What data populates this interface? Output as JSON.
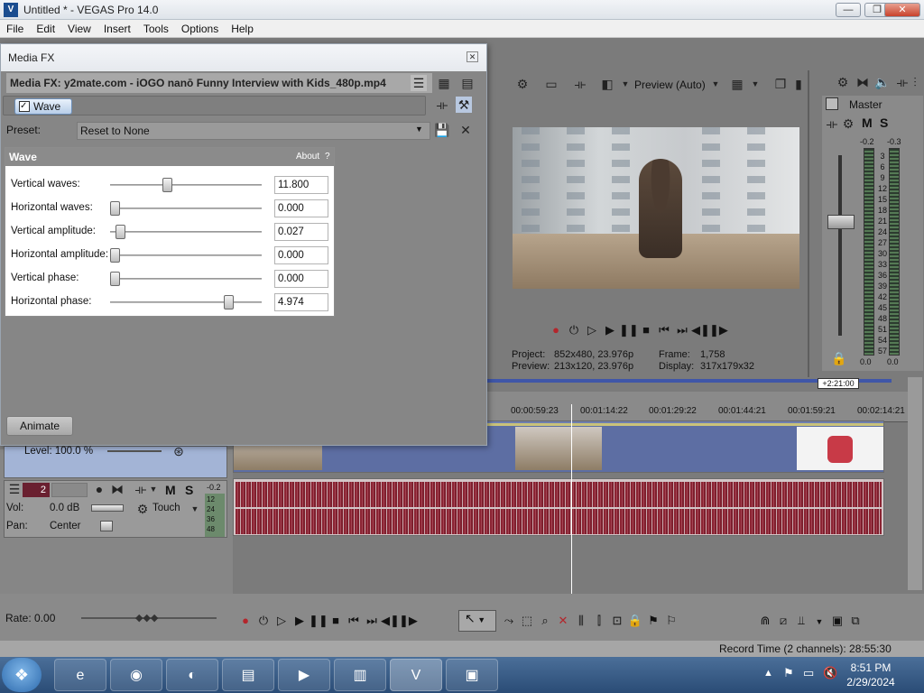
{
  "window": {
    "title": "Untitled * - VEGAS Pro 14.0",
    "min": "—",
    "max": "❐",
    "close": "✕"
  },
  "menu": [
    "File",
    "Edit",
    "View",
    "Insert",
    "Tools",
    "Options",
    "Help"
  ],
  "mediafx": {
    "title": "Media FX",
    "close": "✕",
    "header_label": "Media FX: y2mate.com - iOGO nanō Funny Interview with Kids_480p.mp4",
    "chain_item": "Wave",
    "preset_label": "Preset:",
    "preset_value": "Reset to None",
    "panel_title": "Wave",
    "about": "About",
    "help": "?",
    "params": [
      {
        "label": "Vertical waves:",
        "value": "11.800",
        "pos": 0.36
      },
      {
        "label": "Horizontal waves:",
        "value": "0.000",
        "pos": 0.0
      },
      {
        "label": "Vertical amplitude:",
        "value": "0.027",
        "pos": 0.04
      },
      {
        "label": "Horizontal amplitude:",
        "value": "0.000",
        "pos": 0.0
      },
      {
        "label": "Vertical phase:",
        "value": "0.000",
        "pos": 0.0
      },
      {
        "label": "Horizontal phase:",
        "value": "4.974",
        "pos": 0.79
      }
    ],
    "animate": "Animate"
  },
  "preview": {
    "mode": "Preview (Auto)",
    "project_label": "Project:",
    "project_value": "852x480, 23.976p",
    "preview_label": "Preview:",
    "preview_value": "213x120, 23.976p",
    "frame_label": "Frame:",
    "frame_value": "1,758",
    "display_label": "Display:",
    "display_value": "317x179x32"
  },
  "master": {
    "title": "Master",
    "m": "M",
    "s": "S",
    "peak_l": "-0.2",
    "peak_r": "-0.3",
    "scale": [
      "3",
      "6",
      "9",
      "12",
      "15",
      "18",
      "21",
      "24",
      "27",
      "30",
      "33",
      "36",
      "39",
      "42",
      "45",
      "48",
      "51",
      "54",
      "57"
    ],
    "bottom_l": "0.0",
    "bottom_r": "0.0"
  },
  "timeline": {
    "cursor_time": "+2:21:00",
    "ticks": [
      "00:00:59:23",
      "00:01:14:22",
      "00:01:29:22",
      "00:01:44:21",
      "00:01:59:21",
      "00:02:14:21"
    ]
  },
  "tracks": {
    "video_level": "Level: 100.0 %",
    "audio_num": "2",
    "audio_m": "M",
    "audio_s": "S",
    "audio_peak": "-0.2",
    "audio_scale": [
      "12",
      "24",
      "36",
      "48"
    ],
    "vol_label": "Vol:",
    "vol_value": "0.0 dB",
    "pan_label": "Pan:",
    "pan_value": "Center",
    "touch": "Touch"
  },
  "bottom": {
    "rate_label": "Rate: 0.00"
  },
  "status": {
    "record_time": "Record Time (2 channels): 28:55:30"
  },
  "taskbar": {
    "time": "8:51 PM",
    "date": "2/29/2024"
  }
}
